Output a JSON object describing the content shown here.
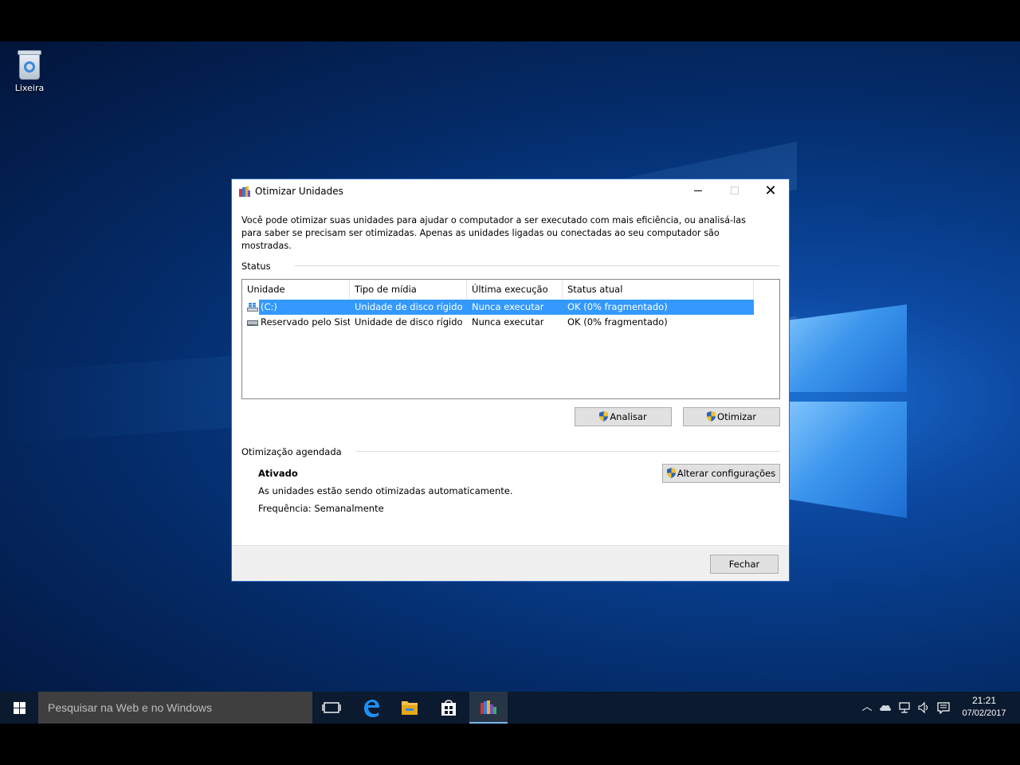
{
  "desktop": {
    "recycle_bin_label": "Lixeira"
  },
  "window": {
    "title": "Otimizar Unidades",
    "description": "Você pode otimizar suas unidades para ajudar o computador a ser executado com mais eficiência, ou analisá-las para saber se precisam ser otimizadas. Apenas as unidades ligadas ou conectadas ao seu computador são mostradas.",
    "status_section": {
      "label": "Status",
      "columns": [
        "Unidade",
        "Tipo de mídia",
        "Última execução",
        "Status atual"
      ],
      "rows": [
        {
          "drive": "(C:)",
          "media": "Unidade de disco rígido",
          "last_run": "Nunca executar",
          "status": "OK (0% fragmentado)",
          "selected": true
        },
        {
          "drive": "Reservado pelo Sist...",
          "media": "Unidade de disco rígido",
          "last_run": "Nunca executar",
          "status": "OK (0% fragmentado)",
          "selected": false
        }
      ],
      "analyze_label": "Analisar",
      "optimize_label": "Otimizar"
    },
    "schedule_section": {
      "label": "Otimização agendada",
      "state": "Ativado",
      "detail": "As unidades estão sendo otimizadas automaticamente.",
      "frequency": "Frequência: Semanalmente",
      "change_settings_label": "Alterar configurações"
    },
    "close_label": "Fechar"
  },
  "taskbar": {
    "search_placeholder": "Pesquisar na Web e no Windows",
    "clock_time": "21:21",
    "clock_date": "07/02/2017"
  },
  "colors": {
    "selection": "#3399ff",
    "taskbar": "#0b1a2e",
    "accent": "#2a6bc4"
  }
}
